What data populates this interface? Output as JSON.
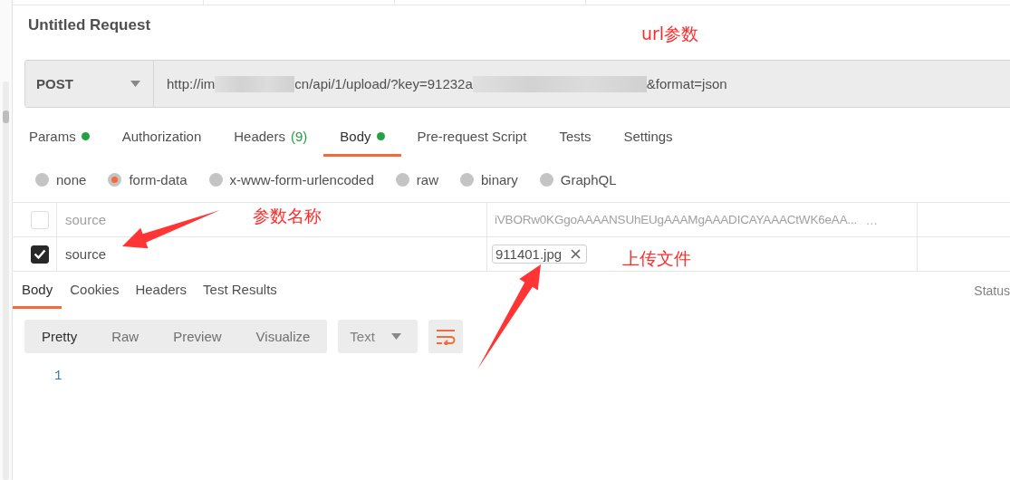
{
  "request_title": "Untitled Request",
  "method": "POST",
  "url_parts": [
    {
      "kind": "text",
      "text": "http://im"
    },
    {
      "kind": "blur"
    },
    {
      "kind": "text",
      "text": "cn/api/1/upload/?key=91232a"
    },
    {
      "kind": "blur"
    },
    {
      "kind": "text",
      "text": "&format=json"
    }
  ],
  "request_tabs": [
    {
      "label": "Params",
      "selected": false,
      "has_content": true
    },
    {
      "label": "Authorization",
      "selected": false,
      "has_content": false
    },
    {
      "label": "Headers",
      "count": "(9)",
      "selected": false,
      "has_content": false
    },
    {
      "label": "Body",
      "selected": true,
      "has_content": true
    },
    {
      "label": "Pre-request Script",
      "selected": false,
      "has_content": false
    },
    {
      "label": "Tests",
      "selected": false,
      "has_content": false
    },
    {
      "label": "Settings",
      "selected": false,
      "has_content": false
    }
  ],
  "body_types": [
    {
      "label": "none",
      "selected": false
    },
    {
      "label": "form-data",
      "selected": true
    },
    {
      "label": "x-www-form-urlencoded",
      "selected": false
    },
    {
      "label": "raw",
      "selected": false
    },
    {
      "label": "binary",
      "selected": false
    },
    {
      "label": "GraphQL",
      "selected": false
    }
  ],
  "form_rows": [
    {
      "checked": false,
      "key": "source",
      "kind": "text",
      "value": "iVBORw0KGgoAAAANSUhEUgAAAMgAAADICAYAAACtWK6eAA...",
      "more": "..."
    },
    {
      "checked": true,
      "key": "source",
      "kind": "file",
      "value": "911401.jpg"
    }
  ],
  "response_tabs": [
    {
      "label": "Body",
      "selected": true
    },
    {
      "label": "Cookies",
      "selected": false
    },
    {
      "label": "Headers",
      "selected": false
    },
    {
      "label": "Test Results",
      "selected": false
    }
  ],
  "response_status": "Status",
  "view_modes": [
    {
      "label": "Pretty",
      "selected": true
    },
    {
      "label": "Raw",
      "selected": false
    },
    {
      "label": "Preview",
      "selected": false
    },
    {
      "label": "Visualize",
      "selected": false
    }
  ],
  "format": "Text",
  "line_numbers": [
    "1"
  ],
  "annotations": [
    "url参数",
    "参数名称",
    "上传文件"
  ]
}
